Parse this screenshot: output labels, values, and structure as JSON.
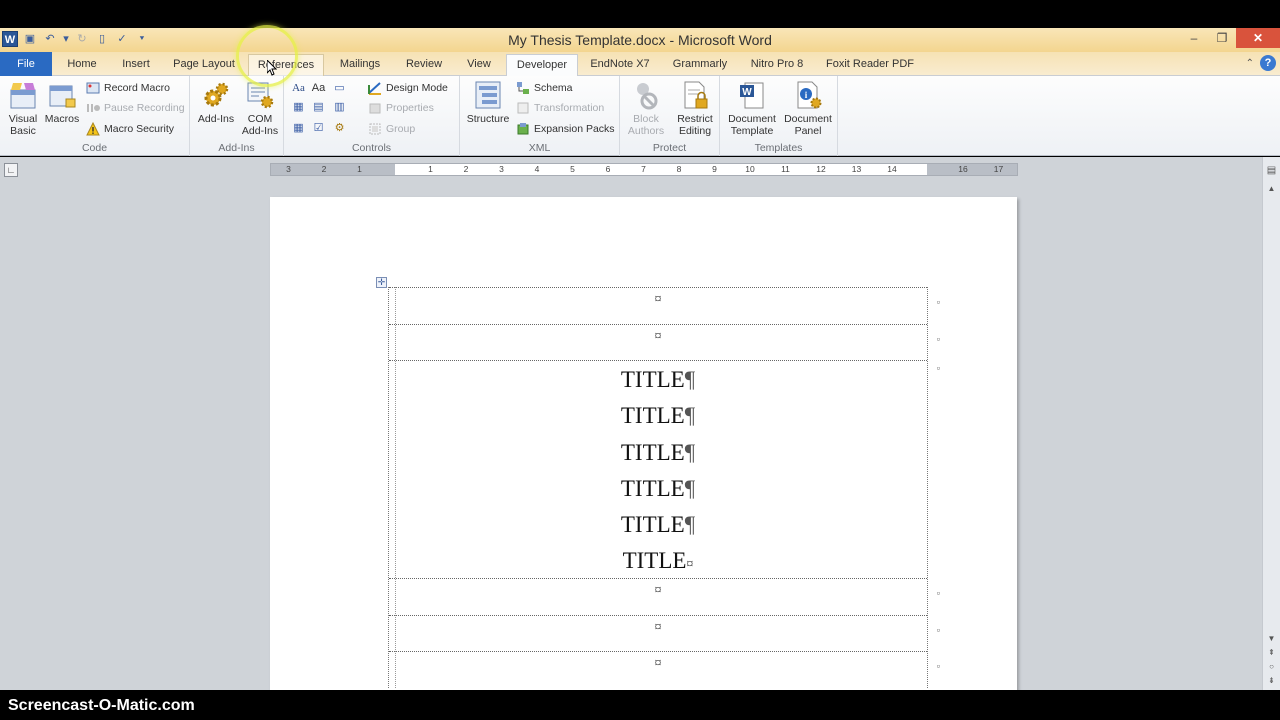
{
  "window": {
    "title": "My Thesis Template.docx - Microsoft Word",
    "controls": {
      "minimize": "‒",
      "restore": "❐",
      "close": "✕"
    }
  },
  "quick_access": {
    "logo": "W",
    "items": [
      "save-icon",
      "undo-icon",
      "redo-icon",
      "new-document-icon",
      "spelling-icon",
      "customize-icon"
    ],
    "glyphs": {
      "save": "▣",
      "undo": "↶",
      "undo_dropdown": "▾",
      "redo": "↻",
      "new": "▯",
      "spelling": "✓",
      "customize": "⯆"
    }
  },
  "tabs": [
    {
      "label": "File",
      "state": "file"
    },
    {
      "label": "Home"
    },
    {
      "label": "Insert"
    },
    {
      "label": "Page Layout"
    },
    {
      "label": "References",
      "state": "hover"
    },
    {
      "label": "Mailings"
    },
    {
      "label": "Review"
    },
    {
      "label": "View"
    },
    {
      "label": "Developer",
      "state": "active"
    },
    {
      "label": "EndNote X7"
    },
    {
      "label": "Grammarly"
    },
    {
      "label": "Nitro Pro 8"
    },
    {
      "label": "Foxit Reader PDF"
    }
  ],
  "tab_right": {
    "collapse": "⌃",
    "help": "?"
  },
  "ribbon": {
    "code": {
      "label": "Code",
      "visual_basic": "Visual\nBasic",
      "visual_basic_l1": "Visual",
      "visual_basic_l2": "Basic",
      "macros": "Macros",
      "record_macro": "Record Macro",
      "pause_recording": "Pause Recording",
      "macro_security": "Macro Security"
    },
    "addins": {
      "label": "Add-Ins",
      "addins": "Add-Ins",
      "com_l1": "COM",
      "com_l2": "Add-Ins"
    },
    "controls": {
      "label": "Controls",
      "design_mode": "Design Mode",
      "properties": "Properties",
      "group": "Group",
      "icons": {
        "rich_text": "Aa",
        "plain_text": "Aa",
        "picture": "▭",
        "building_block": "▦",
        "combo_box": "▤",
        "dropdown": "▥",
        "date_picker": "▦",
        "checkbox": "☑",
        "legacy_tools": "⚙"
      }
    },
    "xml": {
      "label": "XML",
      "structure": "Structure",
      "schema": "Schema",
      "transformation": "Transformation",
      "expansion_packs": "Expansion Packs"
    },
    "protect": {
      "label": "Protect",
      "block_l1": "Block",
      "block_l2": "Authors",
      "restrict_l1": "Restrict",
      "restrict_l2": "Editing"
    },
    "templates": {
      "label": "Templates",
      "doc_template_l1": "Document",
      "doc_template_l2": "Template",
      "doc_panel_l1": "Document",
      "doc_panel_l2": "Panel"
    }
  },
  "ruler": {
    "corner": "∟",
    "left_numbers": [
      "3",
      "2",
      "1"
    ],
    "numbers": [
      "1",
      "2",
      "3",
      "4",
      "5",
      "6",
      "7",
      "8",
      "9",
      "10",
      "11",
      "12",
      "13",
      "14",
      "16",
      "17"
    ]
  },
  "document": {
    "table_move": "✛",
    "cell_end_mark": "¤",
    "row_end_mark": "¤",
    "pilcrow": "¶",
    "title_lines": [
      "TITLE",
      "TITLE",
      "TITLE",
      "TITLE",
      "TITLE",
      "TITLE"
    ],
    "rows_before": 2,
    "rows_after": 3
  },
  "scrollbar": {
    "up": "▲",
    "down": "▼",
    "prev_page": "⇞",
    "select_browse": "○",
    "next_page": "⇟",
    "view_ruler": "▤"
  },
  "watermark": "Screencast-O-Matic.com"
}
